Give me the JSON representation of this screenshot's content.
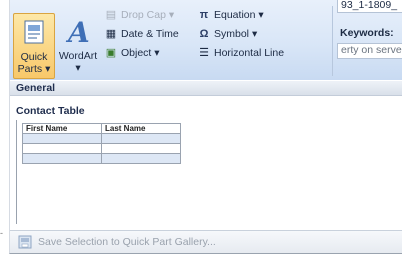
{
  "ribbon": {
    "quick_parts": {
      "line1": "Quick",
      "line2": "Parts",
      "arrow": "▾",
      "icon": "quick-parts-icon"
    },
    "wordart": {
      "label": "WordArt",
      "arrow": "▾",
      "icon": "wordart-icon"
    },
    "drop_cap": {
      "label": "Drop Cap",
      "arrow": "▾",
      "icon": "drop-cap-icon"
    },
    "date_time": {
      "label": "Date & Time",
      "icon": "calendar-icon"
    },
    "object": {
      "label": "Object",
      "arrow": "▾",
      "icon": "object-icon"
    },
    "equation": {
      "label": "Equation",
      "arrow": "▾",
      "glyph": "π",
      "icon": "pi-icon"
    },
    "symbol": {
      "label": "Symbol",
      "arrow": "▾",
      "glyph": "Ω",
      "icon": "omega-icon"
    },
    "horizontal_line": {
      "label": "Horizontal Line",
      "icon": "horizontal-line-icon"
    },
    "doc_field": {
      "value": "93_1-1809_"
    },
    "keywords": {
      "label": "Keywords:"
    },
    "property_field": {
      "value": "erty on serve"
    }
  },
  "gallery": {
    "section_general": "General",
    "item_title": "Contact Table",
    "table": {
      "headers": [
        "First Name",
        "Last Name"
      ],
      "rows": [
        [
          "",
          ""
        ],
        [
          "",
          ""
        ],
        [
          "",
          ""
        ]
      ]
    }
  },
  "footer": {
    "save_label": "Save Selection to Quick Part Gallery...",
    "icon": "save-gallery-icon"
  },
  "gutter_mark": "-"
}
